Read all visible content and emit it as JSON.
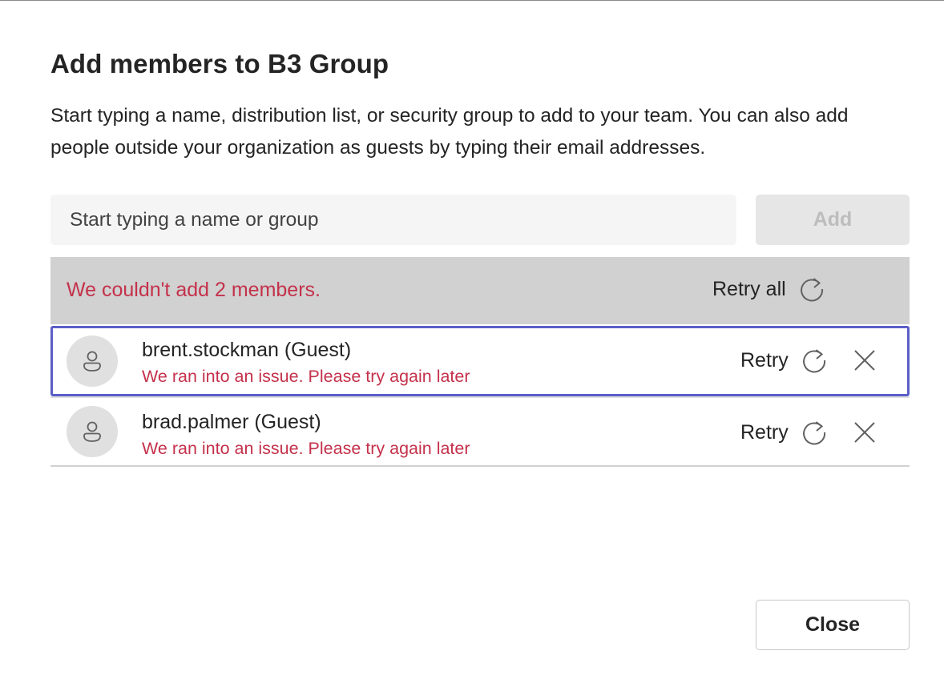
{
  "dialog": {
    "title": "Add members to B3 Group",
    "description": "Start typing a name, distribution list, or security group to add to your team. You can also add people outside your organization as guests by typing their email addresses."
  },
  "search": {
    "placeholder": "Start typing a name or group",
    "value": ""
  },
  "add_button": {
    "label": "Add",
    "disabled": true
  },
  "error_banner": {
    "message": "We couldn't add 2 members.",
    "retry_all_label": "Retry all",
    "retry_icon": "refresh-icon"
  },
  "members": [
    {
      "name": "brent.stockman (Guest)",
      "error": "We ran into an issue. Please try again later",
      "retry_label": "Retry",
      "avatar_icon": "person-icon",
      "remove_icon": "close-icon",
      "focused": true
    },
    {
      "name": "brad.palmer (Guest)",
      "error": "We ran into an issue. Please try again later",
      "retry_label": "Retry",
      "avatar_icon": "person-icon",
      "remove_icon": "close-icon",
      "focused": false
    }
  ],
  "close_button": {
    "label": "Close"
  },
  "colors": {
    "error_text": "#c4314b",
    "banner_bg": "#d1d1d1",
    "focus_outline": "#5b5fc7",
    "input_bg": "#f5f5f5"
  }
}
